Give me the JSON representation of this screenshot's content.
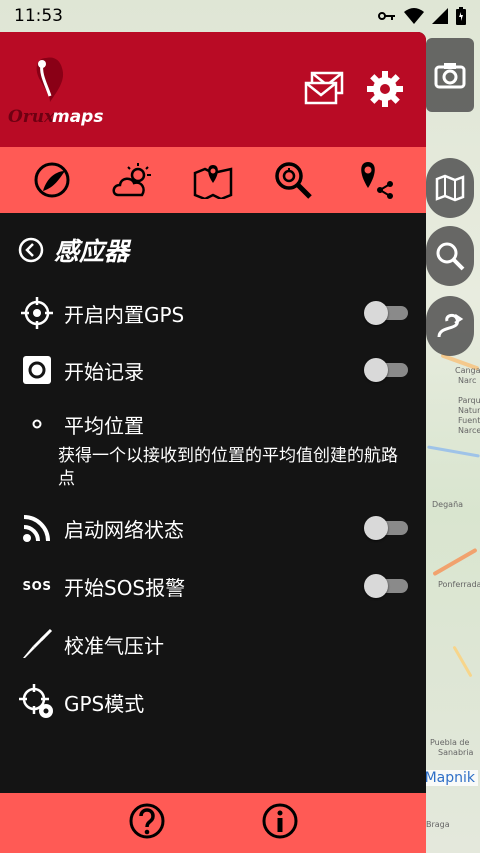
{
  "status_bar": {
    "time": "11:53"
  },
  "app": {
    "logo_text": "Oruxmaps"
  },
  "map": {
    "attribution": "Mapnik",
    "labels": [
      "Cangas",
      "Narc",
      "Parque",
      "Natural",
      "Fuentes",
      "Narcea",
      "Degaña",
      "Ponferrada",
      "Puebla de",
      "Sanabria",
      "Braga"
    ]
  },
  "section": {
    "title": "感应器"
  },
  "menu": {
    "items": [
      {
        "label": "开启内置GPS",
        "toggle": false
      },
      {
        "label": "开始记录",
        "toggle": false
      },
      {
        "label": "平均位置",
        "description": "获得一个以接收到的位置的平均值创建的航路点"
      },
      {
        "label": "启动网络状态",
        "toggle": false
      },
      {
        "label": "开始SOS报警",
        "toggle": false,
        "icon_text": "SOS"
      },
      {
        "label": "校准气压计"
      },
      {
        "label": "GPS模式"
      }
    ]
  },
  "colors": {
    "header": "#b90b25",
    "toolbar": "#ff5a55",
    "drawer_bg": "#141414"
  }
}
